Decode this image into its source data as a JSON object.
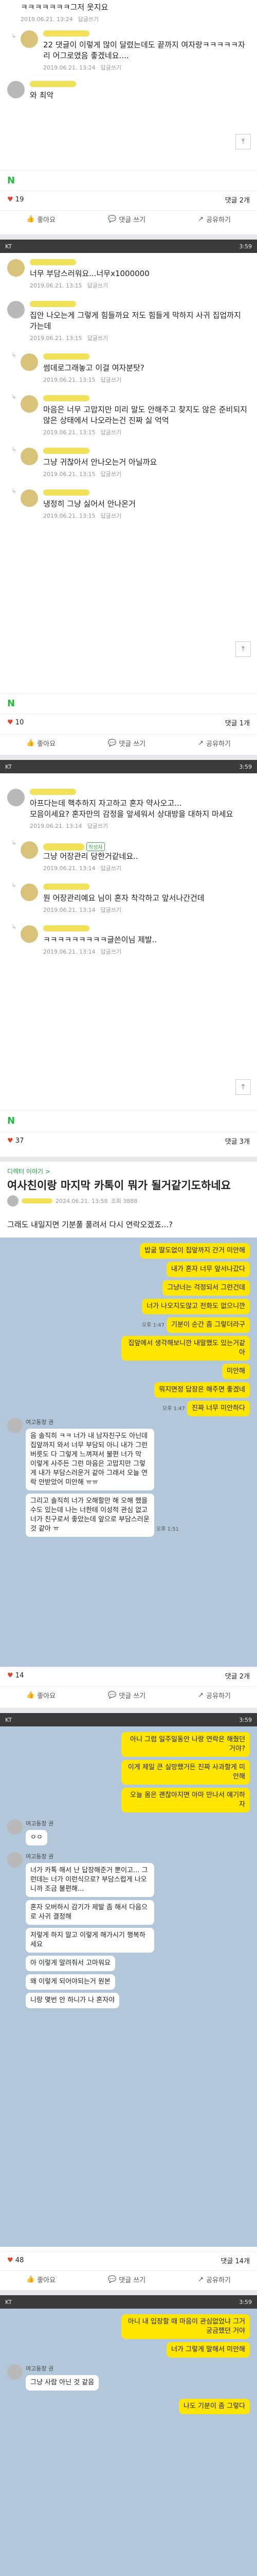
{
  "shot1": {
    "comments": [
      {
        "text": "ㅋㅋㅋㅋㅋㅋㅋ그저 웃지요",
        "date": "2019.06.21. 13:24",
        "reply": "답글쓰기"
      },
      {
        "text": "22 댓글이 이렇게 많이 달렸는데도 끝까지 여자랑ㅋㅋㅋㅋㅋ자리 어그로였음 좋겠네요....",
        "date": "2019.06.21. 13:24",
        "reply": "답글쓰기"
      },
      {
        "text": "와 최악",
        "date": "",
        "reply": ""
      }
    ],
    "likes": "19",
    "comments_count": "댓글 2개",
    "actions": [
      "좋아요",
      "댓글 쓰기",
      "공유하기"
    ]
  },
  "shot2": {
    "status_left": "KT",
    "status_right": "3:59",
    "comments": [
      {
        "text": "너무 부담스러워요...너무x1000000",
        "date": "2019.06.21. 13:15",
        "reply": "답글쓰기"
      },
      {
        "text": "집안 나오는게 그렇게 힘들까요 저도 힘들게 막하지 사귀 집업까지 가는데",
        "date": "2019.06.21. 13:15",
        "reply": "답글쓰기"
      },
      {
        "text": "썸데로그래놓고 이걸 여자분탓?",
        "date": "2019.06.21. 13:15",
        "reply": "답글쓰기"
      },
      {
        "text": "마음은 너무 고맙지만 미리 말도 안해주고 찾지도 않은 준비되지 않은 상태에서 나오라는건 진짜 싫 억억",
        "date": "2019.06.21. 13:15",
        "reply": "답글쓰기"
      },
      {
        "text": "그냥 귀찮아서 안나오는거 아닐까요",
        "date": "2019.06.21. 13:15",
        "reply": "답글쓰기"
      },
      {
        "text": "냉정히 그냥 싫어서 안나온거",
        "date": "2019.06.21. 13:15",
        "reply": "답글쓰기"
      }
    ],
    "likes": "10",
    "comments_count": "댓글 1개",
    "actions": [
      "좋아요",
      "댓글 쓰기",
      "공유하기"
    ]
  },
  "shot3": {
    "comments": [
      {
        "text": "아프다는데 핵추하지 자고하고 혼자 약사오고...",
        "date": "2019.06.21. 13:14",
        "reply": "답글쓰기"
      },
      {
        "text": "모음이세요? 혼자만의 감정을 앞세워서 상대방을 대하지 마세요",
        "date": "2019.06.21. 13:14",
        "reply": "답글쓰기"
      },
      {
        "text": "그냥 어장관리 당한거같네요..",
        "date": "2019.06.21. 13:14",
        "reply": "답글쓰기",
        "writer": "작성자"
      },
      {
        "text": "뭔 어장관리예요 님이 혼자 착각하고 앞서나간건데",
        "date": "2019.06.21. 13:14",
        "reply": "답글쓰기"
      },
      {
        "text": "ㅋㅋㅋㅋㅋㅋㅋㅋㅋ글쓴이님 제발..",
        "date": "2019.06.21. 13:14",
        "reply": "답글쓰기"
      }
    ],
    "likes": "37",
    "comments_count": "댓글 3개"
  },
  "shot4": {
    "board": "디렉터 이야기 >",
    "title": "여사친이랑 마지막 카톡이 뭐가 될거같기도하네요",
    "date": "2024.06.21. 13:58",
    "views": "조회 3888",
    "body": "그래도 내일지면 기분풀 풀려서 다시 연락오겠죠...?",
    "chat": [
      {
        "side": "mine",
        "text": "밥굶 딸도없이 집앞까지 간거 미안해",
        "time": ""
      },
      {
        "side": "mine",
        "text": "내가 혼자 너무 앞서나갔다",
        "time": ""
      },
      {
        "side": "mine",
        "text": "그냥너는 걱정되서 그런건데",
        "time": ""
      },
      {
        "side": "mine",
        "text": "너가 나오지도않고 전화도 없으니깐",
        "time": ""
      },
      {
        "side": "mine",
        "text": "기분이 순간 좀 그렇더라구",
        "time": "오후 1:47"
      },
      {
        "side": "mine",
        "text": "집앞에서 생각해보니깐 내말했도 있는거같아",
        "time": ""
      },
      {
        "side": "mine",
        "text": "미안해",
        "time": ""
      },
      {
        "side": "mine",
        "text": "뭐지면정 답장은 해주면 좋겠네",
        "time": ""
      },
      {
        "side": "mine",
        "text": "진짜 너무 미안하다",
        "time": "오후 1:47"
      },
      {
        "side": "theirs",
        "sender": "여고동창 권",
        "text": "음 솔직히 ㅋㅋ 너가 내 남자친구도 아닌데 집앞까지 와서 너무 부담되 아니 내가 그런 버릇도 다 그렇게 느껴져서 불편 너가 막 이렇게 사주든 그런 마음은 고맙지만 그렇게 내가 부담스러운거 같아 그래서 오늘 연락 안받았어 미안해 ㅠㅠ",
        "time": ""
      },
      {
        "side": "theirs",
        "sender": "",
        "text": "그리고 솔직히 너가 오해할만 해 오해 했을수도 있는데 나는 너한테 이성적 관심 없고 너가 친구로서 좋았는데 앞으로 부담스러운 것 같아 ㅠ",
        "time": "오후 1:51"
      }
    ],
    "likes": "14",
    "comments_count": "댓글 2개",
    "actions": [
      "좋아요",
      "댓글 쓰기",
      "공유하기"
    ]
  },
  "shot5": {
    "chat": [
      {
        "side": "mine",
        "text": "아니 그럼 일주일동안 나랑 연락은 해줬던거야?",
        "time": ""
      },
      {
        "side": "mine",
        "text": "이게 제일 큰 실망했거든 진짜 사과할게 미안해",
        "time": ""
      },
      {
        "side": "mine",
        "text": "오늘 몸은 괜찮아지면 아마 만나서 얘기하자",
        "time": ""
      },
      {
        "side": "theirs",
        "sender": "여고동창 권",
        "text": "ㅇㅇ",
        "time": ""
      },
      {
        "side": "theirs",
        "sender": "여고동창 권",
        "text": "너가 카톡 해서 난 답장해준거 뿐이고... 그런데는 너가 이런식으로? 부담스럽게 나오니까 조금 불편해...",
        "time": ""
      },
      {
        "side": "theirs",
        "sender": "",
        "text": "혼자 오버하시 감기가 제발 좀 해서 다음으로 사귀 결정해",
        "time": ""
      },
      {
        "side": "theirs",
        "sender": "",
        "text": "저렇게 하지 말고 이렇게 해가시기 행복하세요",
        "time": ""
      },
      {
        "side": "theirs",
        "sender": "",
        "text": "아 이렇게 알려줘서 고마워요",
        "time": ""
      },
      {
        "side": "theirs",
        "sender": "",
        "text": "왜 이렇게 되어야되는거 원본",
        "time": ""
      },
      {
        "side": "theirs",
        "sender": "",
        "text": "니랑 몇번 안 하니가 나 혼자야",
        "time": ""
      }
    ],
    "likes": "48",
    "comments_count": "댓글 14개",
    "actions": [
      "좋아요",
      "댓글 쓰기",
      "공유하기"
    ]
  },
  "shot6": {
    "chat": [
      {
        "side": "mine",
        "text": "아니 내 입장할 때 마음이 관심없었냐 그거 궁금했던 거야",
        "time": ""
      },
      {
        "side": "mine",
        "text": "너가 그렇게 말해서 미안해",
        "time": ""
      },
      {
        "side": "theirs",
        "sender": "여고동창 권",
        "text": "그냥 사람 아닌 것 같음",
        "time": ""
      },
      {
        "side": "mine",
        "text": "나도 기분이 좀 그렇다",
        "time": ""
      }
    ]
  }
}
